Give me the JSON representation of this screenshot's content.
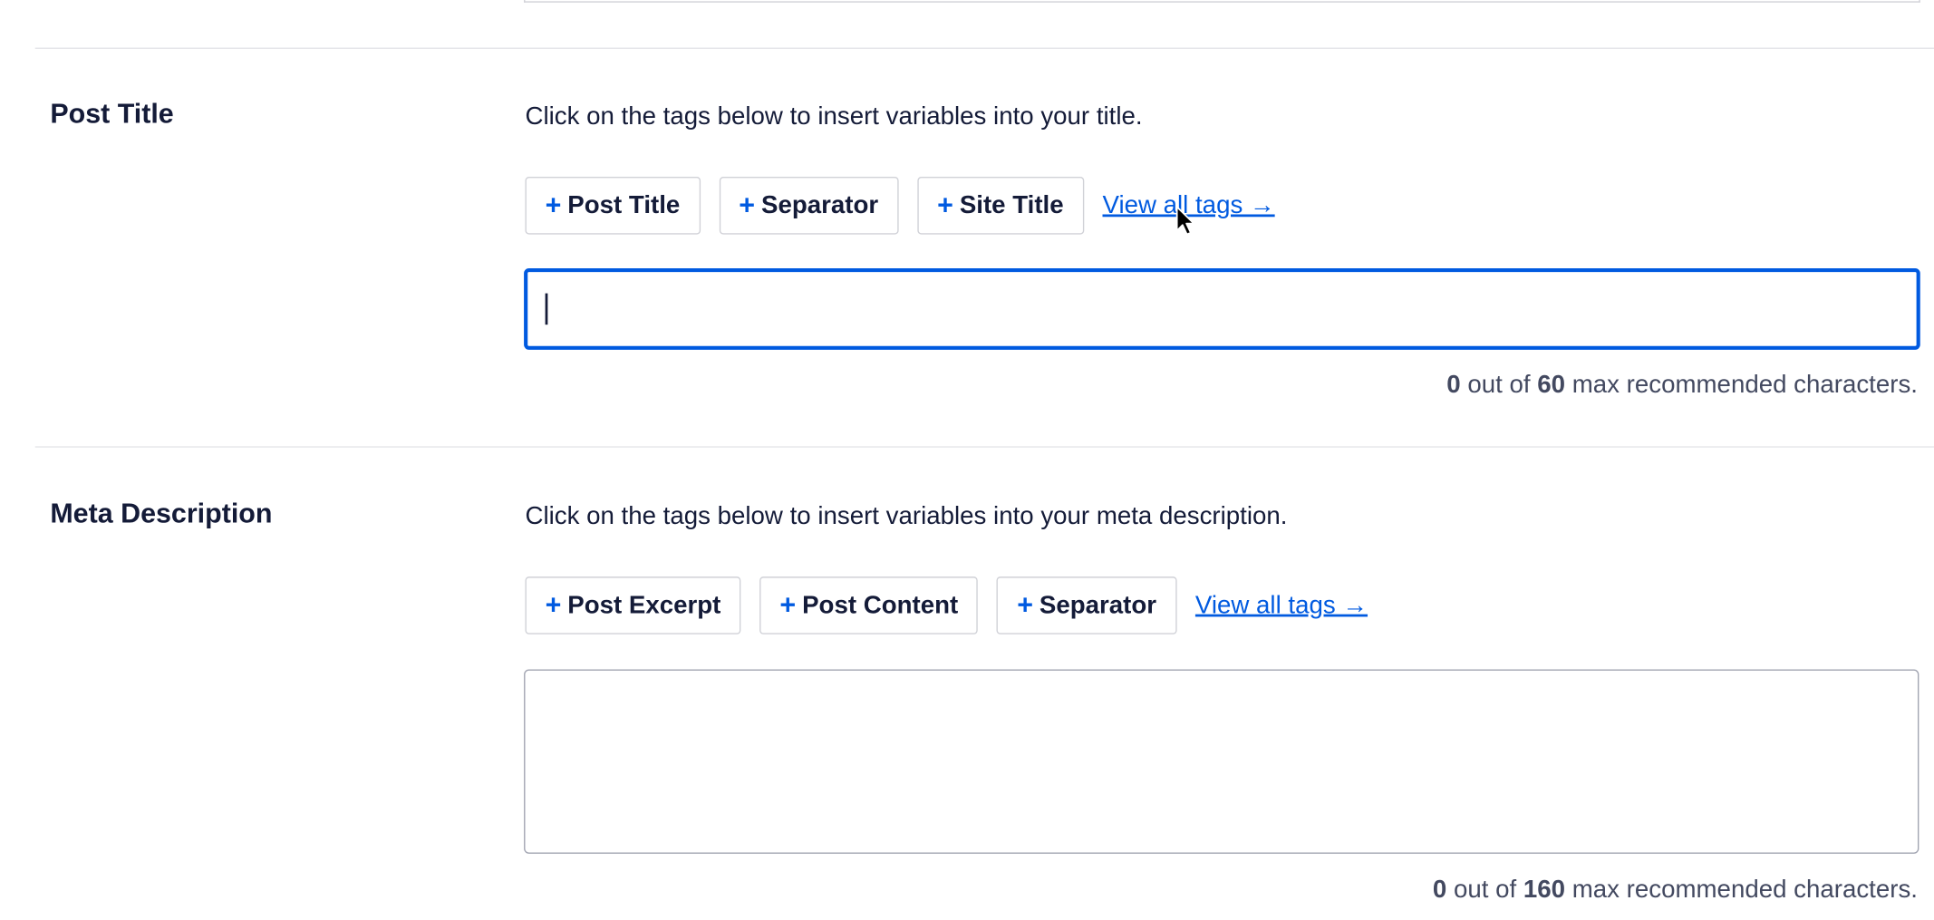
{
  "post_title": {
    "label": "Post Title",
    "hint": "Click on the tags below to insert variables into your title.",
    "tags": [
      {
        "plus": "+",
        "label": "Post Title"
      },
      {
        "plus": "+",
        "label": "Separator"
      },
      {
        "plus": "+",
        "label": "Site Title"
      }
    ],
    "view_all": "View all tags →",
    "input_value": "",
    "counter": {
      "current": "0",
      "mid": " out of ",
      "max": "60",
      "suffix": " max recommended characters."
    }
  },
  "meta_description": {
    "label": "Meta Description",
    "hint": "Click on the tags below to insert variables into your meta description.",
    "tags": [
      {
        "plus": "+",
        "label": "Post Excerpt"
      },
      {
        "plus": "+",
        "label": "Post Content"
      },
      {
        "plus": "+",
        "label": "Separator"
      }
    ],
    "view_all": "View all tags →",
    "input_value": "",
    "counter": {
      "current": "0",
      "mid": " out of ",
      "max": "160",
      "suffix": " max recommended characters."
    }
  },
  "colors": {
    "accent": "#005ae0",
    "text": "#141b38",
    "muted": "#434960",
    "border": "#d0d1d7"
  },
  "icons": {
    "plus": "plus-icon",
    "arrow": "arrow-right-icon",
    "cursor": "mouse-pointer-icon"
  }
}
